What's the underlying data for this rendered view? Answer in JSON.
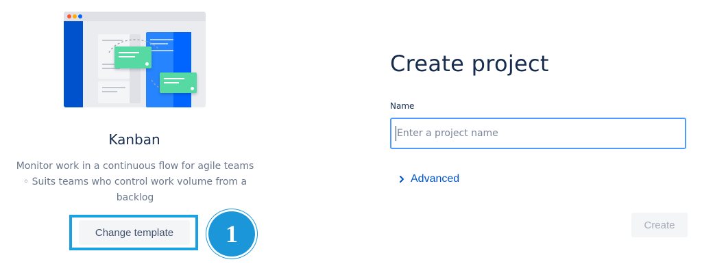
{
  "template": {
    "name": "Kanban",
    "description": "Monitor work in a continuous flow for agile teams ◦ Suits teams who control work volume from a backlog",
    "change_button_label": "Change template",
    "callout_number": "1"
  },
  "form": {
    "title": "Create project",
    "name_label": "Name",
    "name_placeholder": "Enter a project name",
    "name_value": "",
    "advanced_label": "Advanced",
    "create_button_label": "Create"
  },
  "colors": {
    "accent_blue": "#0052cc",
    "highlight_cyan": "#1ba1e2",
    "callout_blue": "#1b96d8",
    "card_green": "#57d9a3"
  },
  "icons": {
    "advanced": "chevron-right-icon"
  }
}
